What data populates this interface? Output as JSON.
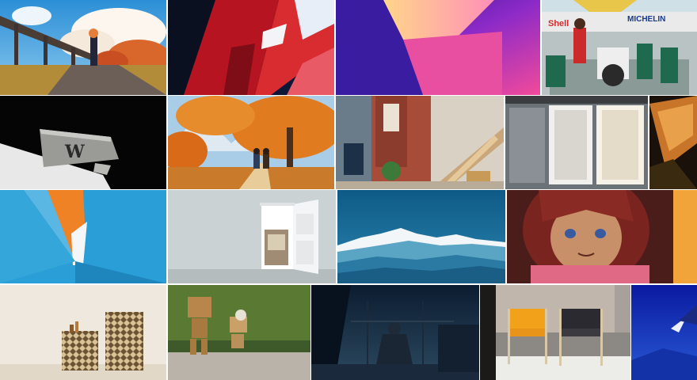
{
  "gallery": {
    "tiles": [
      {
        "name": "anime-autumn-bridge-girl"
      },
      {
        "name": "red-glass-architecture"
      },
      {
        "name": "pink-purple-gradient-room"
      },
      {
        "name": "race-pit-stop-anime"
      },
      {
        "name": "stone-block-w-monochrome"
      },
      {
        "name": "anime-autumn-mountain-path"
      },
      {
        "name": "anime-brick-house-stairs"
      },
      {
        "name": "white-panel-shutters"
      },
      {
        "name": "dark-orange-leaf-closeup"
      },
      {
        "name": "blue-orange-material-fold"
      },
      {
        "name": "open-white-door-room"
      },
      {
        "name": "blue-mountain-range"
      },
      {
        "name": "anime-girl-portrait"
      },
      {
        "name": "patterned-cabinets-interior"
      },
      {
        "name": "danbo-cardboard-robots"
      },
      {
        "name": "anime-girl-window-night"
      },
      {
        "name": "designer-chairs-brick-wall"
      },
      {
        "name": "blue-dunes-partial"
      }
    ],
    "signs": {
      "shell": "Shell",
      "michelin": "MICHELIN",
      "w_letter": "W"
    }
  }
}
